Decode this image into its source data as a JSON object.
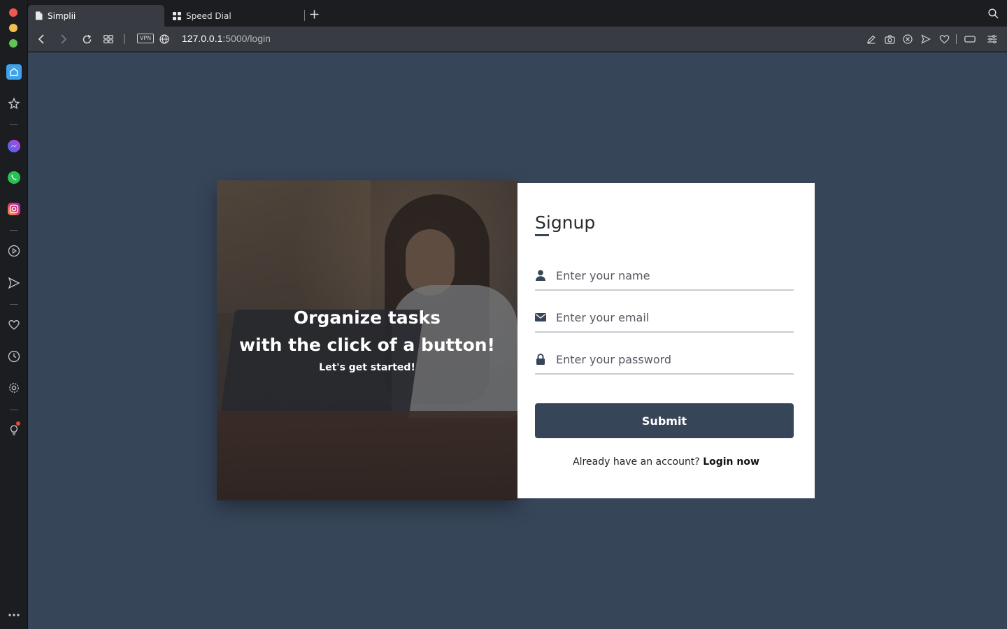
{
  "browser": {
    "tabs": [
      {
        "label": "Simplii",
        "icon": "document-icon",
        "active": true
      },
      {
        "label": "Speed Dial",
        "icon": "grid-icon",
        "active": false
      }
    ],
    "new_tab_icon": "plus-icon",
    "search_icon": "search-icon",
    "url_host": "127.0.0.1",
    "url_path": ":5000/login",
    "vpn_label": "VPN",
    "toolbar_icons": [
      "edit-icon",
      "camera-icon",
      "close-circle-icon",
      "send-icon",
      "heart-icon",
      "battery-icon",
      "settings-sliders-icon"
    ],
    "sidebar_icons": [
      "home-icon",
      "star-icon",
      "messenger-icon",
      "whatsapp-icon",
      "instagram-icon",
      "play-icon",
      "send-icon",
      "heart-icon",
      "clock-icon",
      "gear-icon",
      "lightbulb-icon",
      "more-icon"
    ],
    "colors": {
      "sidebar_home": "#3ea3ec",
      "traffic_red": "#ee5a52",
      "traffic_yellow": "#f4bd4f",
      "traffic_green": "#5fc454"
    }
  },
  "page": {
    "background": "#374559",
    "hero": {
      "line1": "Organize tasks",
      "line2": "with the click of a button!",
      "line3": "Let's get started!"
    },
    "form": {
      "title": "Signup",
      "name_placeholder": "Enter your name",
      "email_placeholder": "Enter your email",
      "password_placeholder": "Enter your password",
      "submit_label": "Submit",
      "footer_text": "Already have an account?",
      "login_link": "Login now"
    }
  }
}
